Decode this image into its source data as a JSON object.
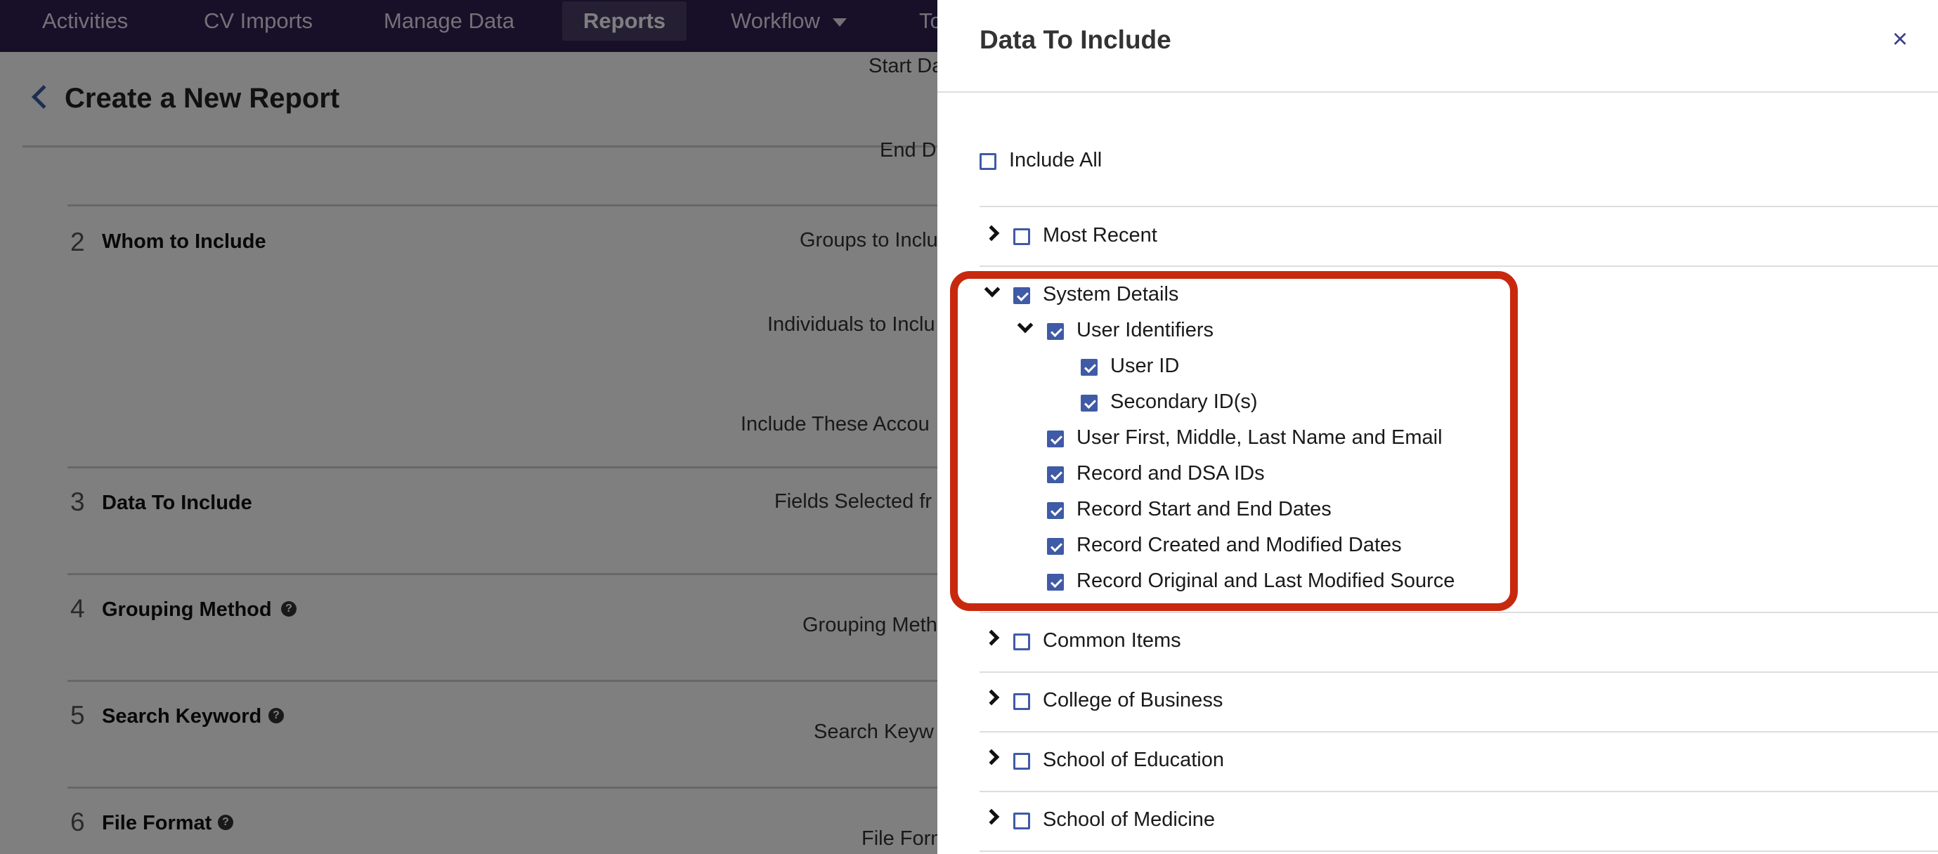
{
  "nav": {
    "items": [
      {
        "label": "Activities"
      },
      {
        "label": "CV Imports"
      },
      {
        "label": "Manage Data"
      },
      {
        "label": "Reports"
      },
      {
        "label": "Workflow"
      },
      {
        "label": "To"
      }
    ],
    "active": "Reports"
  },
  "page": {
    "title": "Create a New Report",
    "labels": {
      "start_date": "Start Da",
      "end_date": "End Da",
      "groups": "Groups to Inclu",
      "individuals": "Individuals to Inclu",
      "accounts": "Include These Accou",
      "fields_selected": "Fields Selected fr",
      "grouping_method": "Grouping Meth",
      "search_keyword": "Search Keyw",
      "file_format": "File Form"
    },
    "sections": [
      {
        "number": "2",
        "title": "Whom to Include"
      },
      {
        "number": "3",
        "title": "Data To Include"
      },
      {
        "number": "4",
        "title": "Grouping Method"
      },
      {
        "number": "5",
        "title": "Search Keyword"
      },
      {
        "number": "6",
        "title": "File Format"
      }
    ]
  },
  "drawer": {
    "title": "Data To Include",
    "close_label": "×",
    "include_all": "Include All",
    "most_recent": "Most Recent",
    "system_details": "System Details",
    "user_identifiers": "User Identifiers",
    "user_id": "User ID",
    "secondary_ids": "Secondary ID(s)",
    "name_email": "User First, Middle, Last Name and Email",
    "record_dsa": "Record and DSA IDs",
    "record_dates": "Record Start and End Dates",
    "record_created": "Record Created and Modified Dates",
    "record_source": "Record Original and Last Modified Source",
    "common_items": "Common Items",
    "college_business": "College of Business",
    "school_education": "School of Education",
    "school_medicine": "School of Medicine"
  },
  "colors": {
    "nav_bg": "#2e2050",
    "checkbox": "#3f5aa6",
    "highlight": "#c8290e"
  }
}
